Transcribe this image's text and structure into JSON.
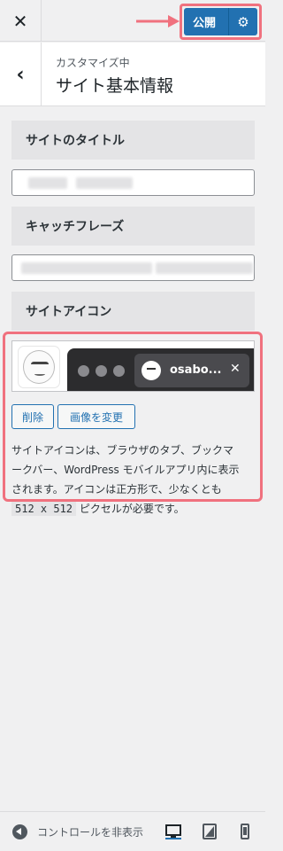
{
  "topbar": {
    "close_label": "✕",
    "publish_label": "公開"
  },
  "header": {
    "subtitle": "カスタマイズ中",
    "title": "サイト基本情報"
  },
  "sections": {
    "site_title": "サイトのタイトル",
    "tagline": "キャッチフレーズ",
    "site_icon": "サイトアイコン"
  },
  "preview": {
    "tab_title": "osabo..."
  },
  "buttons": {
    "remove": "削除",
    "change_image": "画像を変更"
  },
  "description": {
    "line1": "サイトアイコンは、ブラウザのタブ、ブックマ",
    "line2": "ークバー、WordPress モバイルアプリ内に表示",
    "line3": "されます。アイコンは正方形で、少なくとも",
    "code": "512 x 512",
    "line4_tail": " ピクセルが必要です。"
  },
  "footer": {
    "collapse_label": "コントロールを非表示"
  },
  "colors": {
    "accent": "#2271b1",
    "highlight": "#f0717e"
  }
}
